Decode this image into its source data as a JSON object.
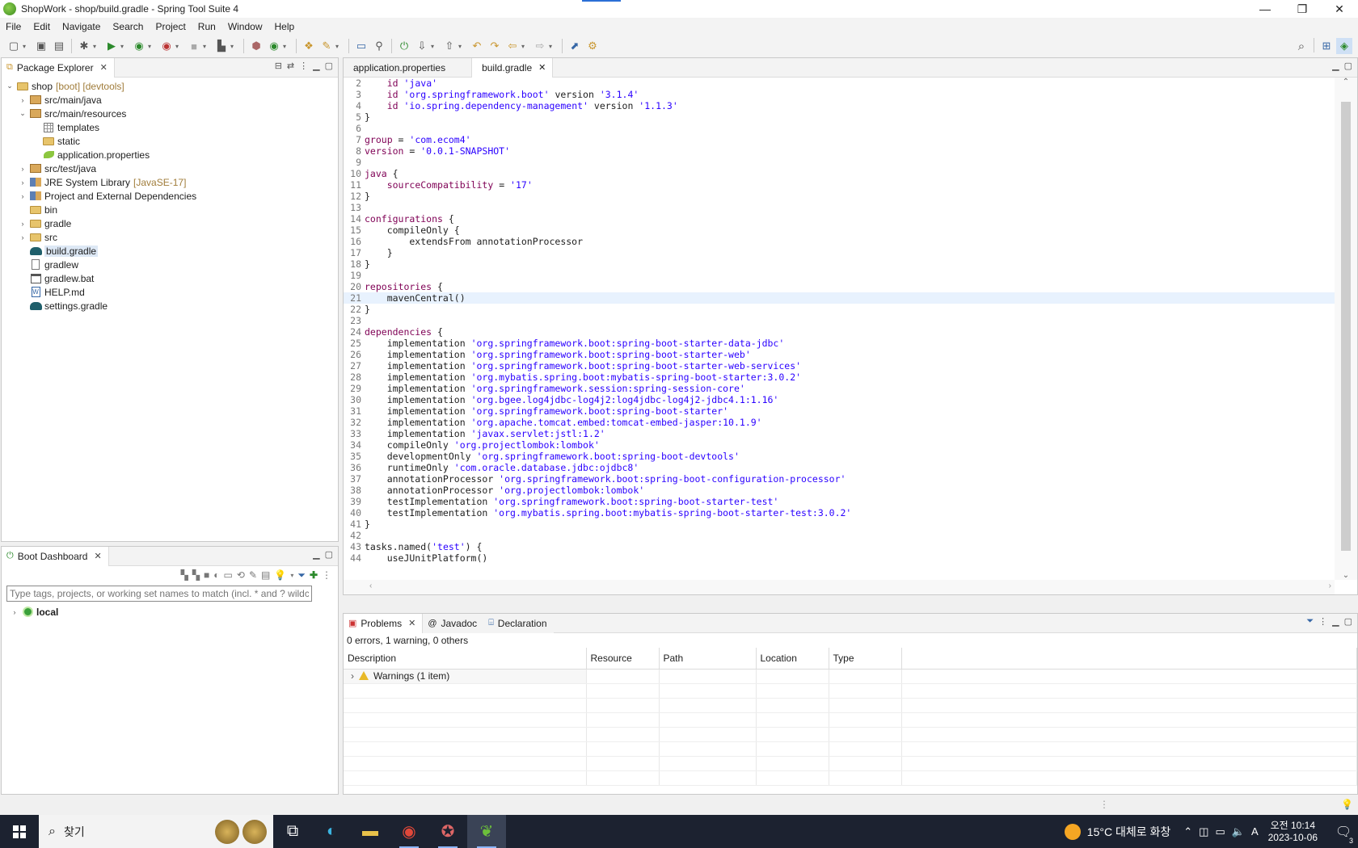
{
  "window": {
    "title": "ShopWork - shop/build.gradle - Spring Tool Suite 4",
    "controls": [
      "—",
      "❐",
      "✕"
    ]
  },
  "menu": [
    "File",
    "Edit",
    "Navigate",
    "Search",
    "Project",
    "Run",
    "Window",
    "Help"
  ],
  "package_explorer": {
    "tab_label": "Package Explorer",
    "tree": [
      {
        "label": "shop",
        "decor": "[boot] [devtools]",
        "icon": "project-icon",
        "twisty": "⌄",
        "indent": 0
      },
      {
        "label": "src/main/java",
        "decor": "",
        "icon": "package-folder-icon",
        "twisty": "›",
        "indent": 1
      },
      {
        "label": "src/main/resources",
        "decor": "",
        "icon": "package-folder-icon",
        "twisty": "⌄",
        "indent": 1
      },
      {
        "label": "templates",
        "decor": "",
        "icon": "grid-folder-icon",
        "twisty": "",
        "indent": 2
      },
      {
        "label": "static",
        "decor": "",
        "icon": "folder-icon",
        "twisty": "",
        "indent": 2
      },
      {
        "label": "application.properties",
        "decor": "",
        "icon": "leaf-icon",
        "twisty": "",
        "indent": 2
      },
      {
        "label": "src/test/java",
        "decor": "",
        "icon": "package-folder-icon",
        "twisty": "›",
        "indent": 1
      },
      {
        "label": "JRE System Library",
        "decor": "[JavaSE-17]",
        "icon": "library-icon",
        "twisty": "›",
        "indent": 1
      },
      {
        "label": "Project and External Dependencies",
        "decor": "",
        "icon": "library-icon",
        "twisty": "›",
        "indent": 1
      },
      {
        "label": "bin",
        "decor": "",
        "icon": "folder-icon",
        "twisty": "",
        "indent": 1
      },
      {
        "label": "gradle",
        "decor": "",
        "icon": "folder-icon",
        "twisty": "›",
        "indent": 1
      },
      {
        "label": "src",
        "decor": "",
        "icon": "folder-icon",
        "twisty": "›",
        "indent": 1
      },
      {
        "label": "build.gradle",
        "decor": "",
        "icon": "gradle-elephant-icon",
        "twisty": "",
        "indent": 1,
        "selected": true
      },
      {
        "label": "gradlew",
        "decor": "",
        "icon": "file-icon",
        "twisty": "",
        "indent": 1
      },
      {
        "label": "gradlew.bat",
        "decor": "",
        "icon": "bat-file-icon",
        "twisty": "",
        "indent": 1
      },
      {
        "label": "HELP.md",
        "decor": "",
        "icon": "markdown-file-icon",
        "twisty": "",
        "indent": 1
      },
      {
        "label": "settings.gradle",
        "decor": "",
        "icon": "gradle-elephant-icon",
        "twisty": "",
        "indent": 1
      }
    ]
  },
  "boot_dashboard": {
    "tab_label": "Boot Dashboard",
    "filter_placeholder": "Type tags, projects, or working set names to match (incl. * and ? wildcards)",
    "items": [
      {
        "label": "local"
      }
    ]
  },
  "editor": {
    "tabs": [
      {
        "label": "application.properties",
        "active": false
      },
      {
        "label": "build.gradle",
        "active": true
      }
    ],
    "current_line": 21,
    "lines": [
      {
        "n": "2",
        "t": "    id 'java'"
      },
      {
        "n": "3",
        "t": "    id 'org.springframework.boot' version '3.1.4'"
      },
      {
        "n": "4",
        "t": "    id 'io.spring.dependency-management' version '1.1.3'"
      },
      {
        "n": "5",
        "t": "}"
      },
      {
        "n": "6",
        "t": ""
      },
      {
        "n": "7",
        "t": "group = 'com.ecom4'"
      },
      {
        "n": "8",
        "t": "version = '0.0.1-SNAPSHOT'"
      },
      {
        "n": "9",
        "t": ""
      },
      {
        "n": "10",
        "t": "java {"
      },
      {
        "n": "11",
        "t": "    sourceCompatibility = '17'"
      },
      {
        "n": "12",
        "t": "}"
      },
      {
        "n": "13",
        "t": ""
      },
      {
        "n": "14",
        "t": "configurations {"
      },
      {
        "n": "15",
        "t": "    compileOnly {"
      },
      {
        "n": "16",
        "t": "        extendsFrom annotationProcessor"
      },
      {
        "n": "17",
        "t": "    }"
      },
      {
        "n": "18",
        "t": "}"
      },
      {
        "n": "19",
        "t": ""
      },
      {
        "n": "20",
        "t": "repositories {"
      },
      {
        "n": "21",
        "t": "    mavenCentral()"
      },
      {
        "n": "22",
        "t": "}"
      },
      {
        "n": "23",
        "t": ""
      },
      {
        "n": "24",
        "t": "dependencies {"
      },
      {
        "n": "25",
        "t": "    implementation 'org.springframework.boot:spring-boot-starter-data-jdbc'"
      },
      {
        "n": "26",
        "t": "    implementation 'org.springframework.boot:spring-boot-starter-web'"
      },
      {
        "n": "27",
        "t": "    implementation 'org.springframework.boot:spring-boot-starter-web-services'"
      },
      {
        "n": "28",
        "t": "    implementation 'org.mybatis.spring.boot:mybatis-spring-boot-starter:3.0.2'"
      },
      {
        "n": "29",
        "t": "    implementation 'org.springframework.session:spring-session-core'"
      },
      {
        "n": "30",
        "t": "    implementation 'org.bgee.log4jdbc-log4j2:log4jdbc-log4j2-jdbc4.1:1.16'"
      },
      {
        "n": "31",
        "t": "    implementation 'org.springframework.boot:spring-boot-starter'"
      },
      {
        "n": "32",
        "t": "    implementation 'org.apache.tomcat.embed:tomcat-embed-jasper:10.1.9'"
      },
      {
        "n": "33",
        "t": "    implementation 'javax.servlet:jstl:1.2'"
      },
      {
        "n": "34",
        "t": "    compileOnly 'org.projectlombok:lombok'"
      },
      {
        "n": "35",
        "t": "    developmentOnly 'org.springframework.boot:spring-boot-devtools'"
      },
      {
        "n": "36",
        "t": "    runtimeOnly 'com.oracle.database.jdbc:ojdbc8'"
      },
      {
        "n": "37",
        "t": "    annotationProcessor 'org.springframework.boot:spring-boot-configuration-processor'"
      },
      {
        "n": "38",
        "t": "    annotationProcessor 'org.projectlombok:lombok'"
      },
      {
        "n": "39",
        "t": "    testImplementation 'org.springframework.boot:spring-boot-starter-test'"
      },
      {
        "n": "40",
        "t": "    testImplementation 'org.mybatis.spring.boot:mybatis-spring-boot-starter-test:3.0.2'"
      },
      {
        "n": "41",
        "t": "}"
      },
      {
        "n": "42",
        "t": ""
      },
      {
        "n": "43",
        "t": "tasks.named('test') {"
      },
      {
        "n": "44",
        "t": "    useJUnitPlatform()"
      }
    ]
  },
  "problems": {
    "tabs": [
      {
        "label": "Problems",
        "icon": "problems-icon"
      },
      {
        "label": "Javadoc",
        "icon": "at-icon"
      },
      {
        "label": "Declaration",
        "icon": "declaration-icon"
      }
    ],
    "summary": "0 errors, 1 warning, 0 others",
    "columns": [
      "Description",
      "Resource",
      "Path",
      "Location",
      "Type"
    ],
    "rows": [
      {
        "description": "Warnings (1 item)"
      }
    ]
  },
  "taskbar": {
    "search_label": "찾기",
    "weather": "15°C  대체로 화창",
    "time": "오전 10:14",
    "date": "2023-10-06",
    "ime": "A",
    "notification_count": "3"
  },
  "colors": {
    "keyword": "#7f0055",
    "string": "#2a00ff",
    "selection": "#dde8f5",
    "current_line": "#e8f2fe",
    "taskbar": "#1c2230"
  }
}
